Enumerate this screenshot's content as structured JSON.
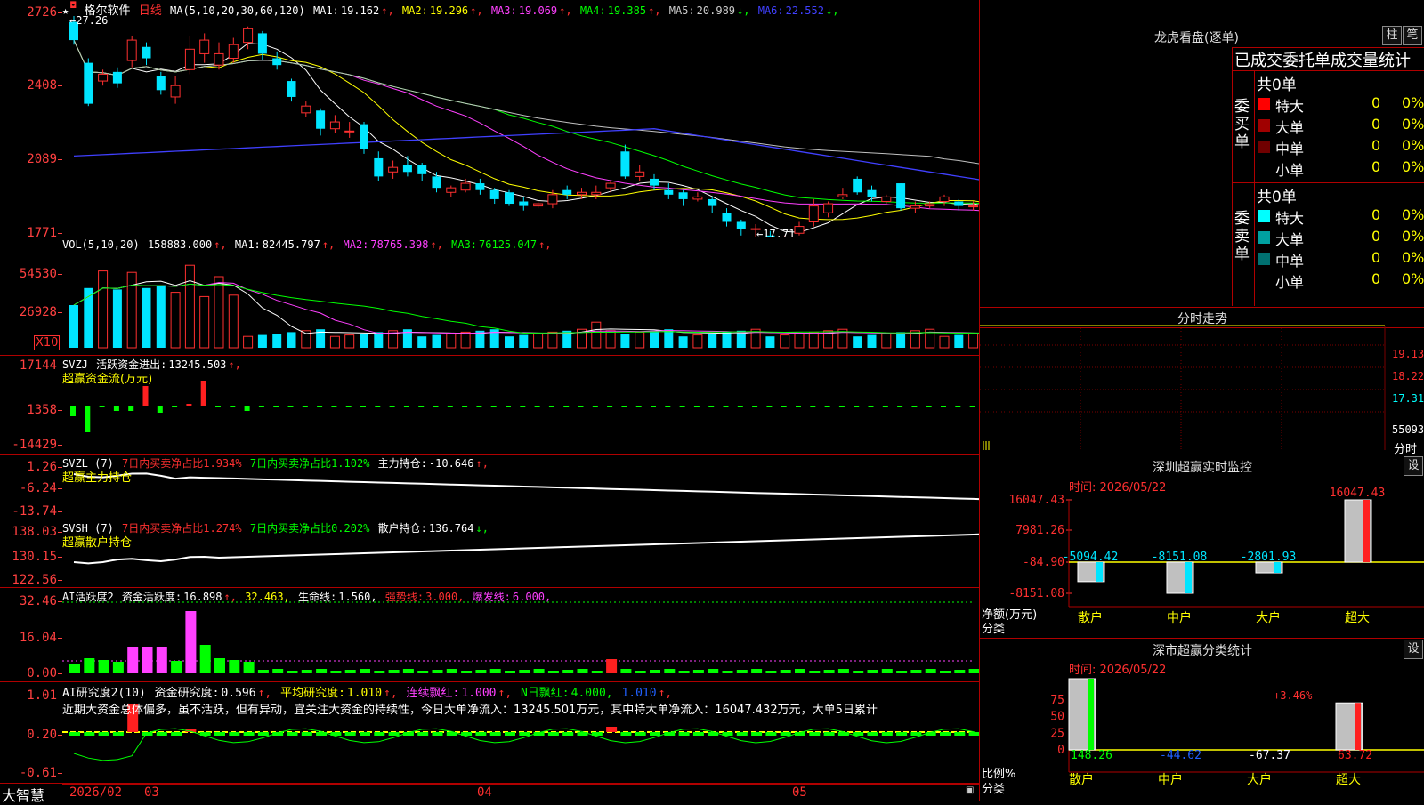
{
  "app_name": "大智慧",
  "stock": {
    "name": "格尔软件",
    "period": "日线",
    "max_label": "27.26",
    "min_label": "17.71"
  },
  "colors": {
    "up": "#ff3030",
    "down": "#00e5ff",
    "green": "#00ff00",
    "magenta": "#ff40ff",
    "yellow": "#ffff00",
    "axis": "#b00000"
  },
  "price_panel": {
    "ma_header": "MA(5,10,20,30,60,120)",
    "ma_items": [
      {
        "label": "MA1:",
        "value": "19.162",
        "arrow": "↑",
        "color": "#ffffff"
      },
      {
        "label": "MA2:",
        "value": "19.296",
        "arrow": "↑",
        "color": "#ffff00"
      },
      {
        "label": "MA3:",
        "value": "19.069",
        "arrow": "↑",
        "color": "#ff40ff"
      },
      {
        "label": "MA4:",
        "value": "19.385",
        "arrow": "↑",
        "color": "#00ff00"
      },
      {
        "label": "MA5:",
        "value": "20.989",
        "arrow": "↓",
        "color": "#cccccc"
      },
      {
        "label": "MA6:",
        "value": "22.552",
        "arrow": "↓",
        "color": "#4040ff"
      }
    ],
    "y_ticks": [
      "2726",
      "2408",
      "2089",
      "1771"
    ]
  },
  "vol_panel": {
    "header": "VOL(5,10,20)",
    "value": "158883.000",
    "items": [
      {
        "label": "MA1:",
        "value": "82445.797",
        "arrow": "↑",
        "color": "#ffffff"
      },
      {
        "label": "MA2:",
        "value": "78765.398",
        "arrow": "↑",
        "color": "#ff40ff"
      },
      {
        "label": "MA3:",
        "value": "76125.047",
        "arrow": "↑",
        "color": "#00ff00"
      }
    ],
    "y_ticks": [
      "54530",
      "26928"
    ],
    "unit": "X10"
  },
  "svzj_panel": {
    "header": "SVZJ",
    "label": "活跃资金进出:",
    "value": "13245.503",
    "arrow": "↑,",
    "subtitle": "超赢资金流(万元)",
    "y_ticks": [
      "17144",
      "1358",
      "-14429"
    ]
  },
  "svzl_panel": {
    "header": "SVZL (7)",
    "t1": "7日内买卖净占比1.934%",
    "t2": "7日内买卖净占比1.102%",
    "t3": "主力持仓:",
    "t3_value": "-10.646",
    "arrow": "↑,",
    "subtitle": "超赢主力持仓",
    "y_ticks": [
      "1.26",
      "-6.24",
      "-13.74"
    ]
  },
  "svsh_panel": {
    "header": "SVSH (7)",
    "t1": "7日内买卖净占比1.274%",
    "t2": "7日内买卖净占比0.202%",
    "t3": "散户持仓:",
    "t3_value": "136.764",
    "arrow": "↓,",
    "subtitle": "超赢散户持仓",
    "y_ticks": [
      "138.03",
      "130.15",
      "122.56"
    ]
  },
  "ai_active_panel": {
    "header": "AI活跃度2",
    "t1": "资金活跃度:",
    "v1": "16.898",
    "a1": "↑,",
    "v2": "32.463,",
    "t3": "生命线:",
    "v3": "1.560,",
    "t4": "强势线:",
    "v4": "3.000,",
    "t5": "爆发线:",
    "v5": "6.000,",
    "y_ticks": [
      "32.46",
      "16.04",
      "0.00"
    ]
  },
  "ai_research_panel": {
    "header": "AI研究度2(10)",
    "t1": "资金研究度:",
    "v1": "0.596",
    "a1": "↑,",
    "t2": "平均研究度:",
    "v2": "1.010",
    "a2": "↑,",
    "t3": "连续飘红:",
    "v3": "1.000",
    "a3": "↑,",
    "t4": "N日飘红:",
    "v4": "4.000,",
    "v5": "1.010",
    "a5": "↑,",
    "comment": "近期大资金总体偏多，虽不活跃，但有异动，宜关注大资金的持续性，今日大单净流入：13245.501万元，其中特大单净流入：16047.432万元，大单5日累计",
    "y_ticks": [
      "1.01",
      "0.20",
      "-0.61"
    ]
  },
  "x_axis": {
    "labels": [
      "2026/02",
      "03",
      "04",
      "05"
    ]
  },
  "dragon": {
    "title": "龙虎看盘(逐单)",
    "btn_bar": "柱",
    "btn_pen": "笔",
    "header": "已成交委托单成交量统计",
    "buy_label": "委买单",
    "sell_label": "委卖单",
    "buy_total": "共0单",
    "sell_total": "共0单",
    "buy_rows": [
      {
        "name": "特大",
        "count": "0",
        "pct": "0%",
        "color": "#ff0000"
      },
      {
        "name": "大单",
        "count": "0",
        "pct": "0%",
        "color": "#a00000"
      },
      {
        "name": "中单",
        "count": "0",
        "pct": "0%",
        "color": "#700000"
      },
      {
        "name": "小单",
        "count": "0",
        "pct": "0%",
        "color": ""
      }
    ],
    "sell_rows": [
      {
        "name": "特大",
        "count": "0",
        "pct": "0%",
        "color": "#00ffff"
      },
      {
        "name": "大单",
        "count": "0",
        "pct": "0%",
        "color": "#00a0a0"
      },
      {
        "name": "中单",
        "count": "0",
        "pct": "0%",
        "color": "#007070"
      },
      {
        "name": "小单",
        "count": "0",
        "pct": "0%",
        "color": ""
      }
    ]
  },
  "intraday": {
    "title": "分时走势",
    "y_ticks": [
      "19.13",
      "18.22",
      "17.31"
    ],
    "vol_label": "55093",
    "footer": "分时"
  },
  "sz_monitor": {
    "title": "深圳超赢实时监控",
    "btn": "设",
    "time": "时间: 2026/05/22",
    "y_ticks": [
      "16047.43",
      "7981.26",
      "-84.90",
      "-8151.08"
    ],
    "ylabel": "净额(万元)",
    "xlabel": "分类",
    "bars": [
      {
        "name": "散户",
        "value": -5094.42,
        "label": "-5094.42"
      },
      {
        "name": "中户",
        "value": -8151.08,
        "label": "-8151.08"
      },
      {
        "name": "大户",
        "value": -2801.93,
        "label": "-2801.93"
      },
      {
        "name": "超大",
        "value": 16047.43,
        "label": "16047.43"
      }
    ]
  },
  "sz_class": {
    "title": "深市超赢分类统计",
    "btn": "设",
    "time": "时间: 2026/05/22",
    "y_ticks": [
      "75",
      "50",
      "25",
      "0"
    ],
    "ylabel": "比例%",
    "xlabel": "分类",
    "annotation": "+3.46%",
    "bars": [
      {
        "name": "散户",
        "value": 148.26,
        "label": "148.26",
        "color": "#00ff00"
      },
      {
        "name": "中户",
        "value": -44.62,
        "label": "-44.62",
        "color": "#2060ff"
      },
      {
        "name": "大户",
        "value": -67.37,
        "label": "-67.37",
        "color": "#ffffff"
      },
      {
        "name": "超大",
        "value": 63.72,
        "label": "63.72",
        "color": "#ff2020"
      }
    ]
  },
  "chart_data": {
    "type": "candlestick",
    "candles": [
      [
        27.0,
        26.2,
        27.26,
        26.0
      ],
      [
        25.2,
        23.4,
        25.4,
        23.3
      ],
      [
        24.4,
        24.7,
        24.9,
        24.2
      ],
      [
        24.8,
        24.3,
        25.0,
        24.1
      ],
      [
        25.3,
        26.2,
        26.4,
        25.0
      ],
      [
        25.9,
        25.4,
        26.1,
        25.1
      ],
      [
        24.6,
        24.0,
        24.8,
        23.8
      ],
      [
        23.7,
        24.2,
        24.6,
        23.4
      ],
      [
        24.9,
        25.8,
        26.4,
        24.7
      ],
      [
        25.6,
        26.2,
        26.5,
        25.2
      ],
      [
        25.1,
        25.6,
        26.1,
        24.9
      ],
      [
        25.4,
        26.0,
        26.3,
        25.2
      ],
      [
        26.1,
        26.7,
        26.8,
        25.8
      ],
      [
        26.5,
        25.6,
        26.6,
        25.3
      ],
      [
        25.4,
        25.1,
        25.7,
        24.9
      ],
      [
        24.4,
        23.7,
        24.5,
        23.5
      ],
      [
        23.0,
        23.3,
        23.5,
        22.8
      ],
      [
        23.1,
        22.3,
        23.2,
        22.0
      ],
      [
        22.3,
        22.6,
        22.9,
        22.1
      ],
      [
        22.2,
        22.2,
        22.6,
        21.9
      ],
      [
        22.5,
        21.4,
        22.6,
        21.2
      ],
      [
        21.0,
        20.2,
        21.3,
        20.0
      ],
      [
        20.4,
        20.6,
        20.9,
        20.1
      ],
      [
        20.7,
        20.4,
        21.1,
        20.2
      ],
      [
        20.7,
        20.3,
        20.8,
        20.0
      ],
      [
        20.2,
        19.7,
        20.4,
        19.5
      ],
      [
        19.5,
        19.7,
        19.8,
        19.3
      ],
      [
        19.6,
        19.9,
        20.1,
        19.5
      ],
      [
        19.9,
        19.6,
        20.1,
        19.4
      ],
      [
        19.6,
        19.2,
        19.7,
        19.0
      ],
      [
        19.5,
        19.0,
        19.6,
        18.9
      ],
      [
        19.1,
        18.9,
        19.3,
        18.7
      ],
      [
        18.9,
        19.0,
        19.1,
        18.8
      ],
      [
        19.0,
        19.4,
        19.6,
        18.8
      ],
      [
        19.6,
        19.4,
        19.8,
        19.2
      ],
      [
        19.4,
        19.5,
        19.7,
        19.2
      ],
      [
        19.4,
        19.5,
        19.8,
        19.2
      ],
      [
        19.7,
        19.9,
        20.0,
        19.5
      ],
      [
        21.3,
        20.2,
        21.6,
        20.1
      ],
      [
        20.2,
        20.4,
        20.7,
        20.0
      ],
      [
        20.1,
        19.8,
        20.3,
        19.6
      ],
      [
        19.6,
        19.4,
        19.9,
        19.2
      ],
      [
        19.5,
        19.2,
        19.6,
        18.9
      ],
      [
        19.2,
        19.3,
        19.5,
        19.1
      ],
      [
        19.2,
        18.9,
        19.3,
        18.6
      ],
      [
        18.6,
        18.2,
        18.8,
        18.0
      ],
      [
        18.2,
        17.9,
        18.3,
        17.6
      ],
      [
        17.9,
        17.9,
        18.1,
        17.5
      ],
      [
        17.6,
        17.4,
        17.8,
        17.2
      ],
      [
        17.3,
        17.5,
        17.6,
        17.1
      ],
      [
        17.7,
        18.0,
        18.2,
        17.6
      ],
      [
        18.2,
        18.9,
        19.2,
        18.0
      ],
      [
        18.6,
        19.0,
        19.1,
        18.4
      ],
      [
        19.3,
        19.4,
        19.7,
        19.2
      ],
      [
        20.1,
        19.5,
        20.2,
        19.4
      ],
      [
        19.6,
        19.3,
        19.8,
        19.1
      ],
      [
        19.1,
        19.3,
        19.4,
        19.0
      ],
      [
        19.9,
        18.8,
        19.9,
        18.7
      ],
      [
        18.8,
        18.9,
        19.1,
        18.6
      ],
      [
        18.9,
        19.0,
        19.1,
        18.8
      ],
      [
        19.1,
        19.3,
        19.4,
        18.9
      ],
      [
        19.1,
        18.9,
        19.2,
        18.7
      ],
      [
        18.9,
        18.9,
        19.1,
        18.7
      ],
      [
        18.9,
        18.3,
        19.0,
        18.2
      ],
      [
        18.3,
        19.0,
        19.3,
        18.2
      ]
    ],
    "ylim": [
      17.71,
      27.26
    ]
  }
}
